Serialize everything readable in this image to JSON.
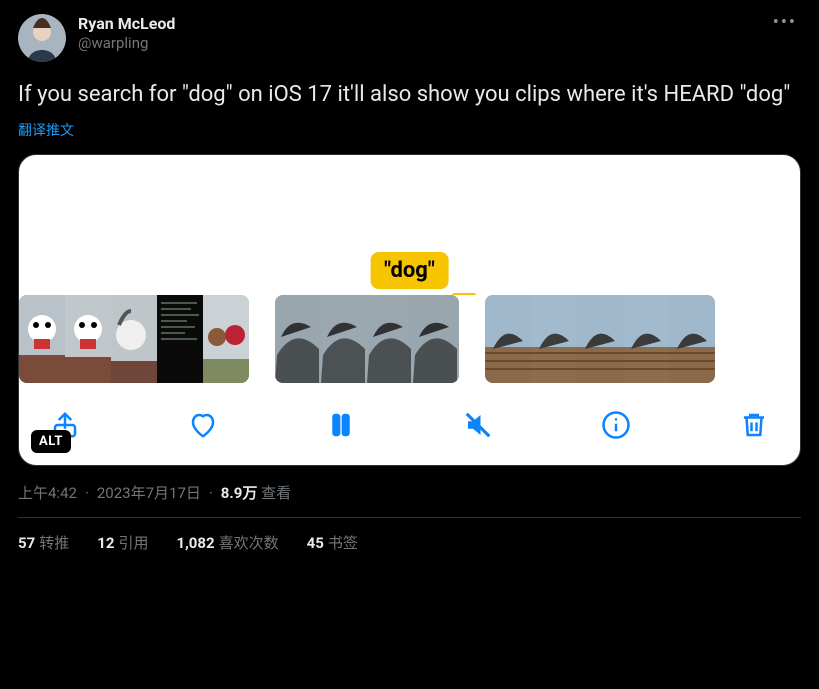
{
  "author": {
    "name": "Ryan McLeod",
    "handle": "@warpling"
  },
  "body": "If you search for \"dog\" on iOS 17 it'll also show you clips where it's HEARD \"dog\"",
  "translate": "翻译推文",
  "media": {
    "tag": "\"dog\"",
    "alt_label": "ALT"
  },
  "icons": {
    "share": "share-icon",
    "heart": "heart-icon",
    "pause": "pause-icon",
    "mute": "mute-icon",
    "info": "info-icon",
    "trash": "trash-icon"
  },
  "meta": {
    "time": "上午4:42",
    "date": "2023年7月17日",
    "views_count": "8.9万",
    "views_label": "查看"
  },
  "stats": {
    "retweets": {
      "count": "57",
      "label": "转推"
    },
    "quotes": {
      "count": "12",
      "label": "引用"
    },
    "likes": {
      "count": "1,082",
      "label": "喜欢次数"
    },
    "bookmarks": {
      "count": "45",
      "label": "书签"
    }
  }
}
